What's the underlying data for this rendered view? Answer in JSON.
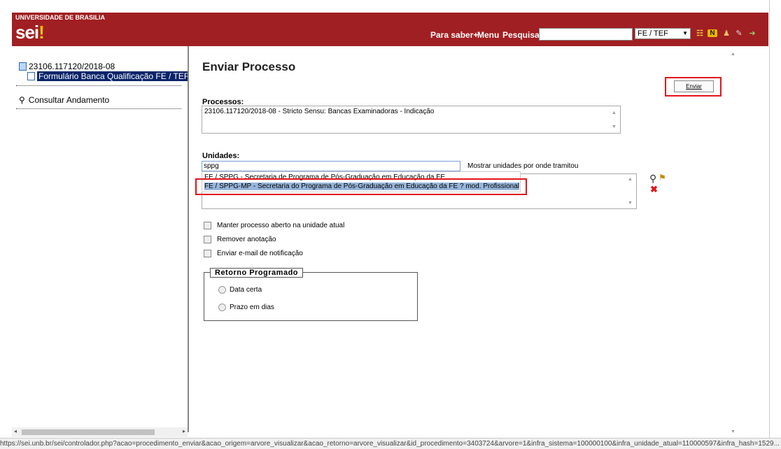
{
  "header": {
    "institution": "UNIVERSIDADE DE BRASILIA",
    "logo_text": "sei",
    "links": [
      "Para saber+",
      "Menu",
      "Pesquisa"
    ],
    "search_value": "",
    "unit_select": "FE / TEF",
    "icons": [
      "list-icon",
      "notification-n-icon",
      "user-icon",
      "tools-icon",
      "exit-icon"
    ]
  },
  "tree": {
    "process_number": "23106.117120/2018-08",
    "document": "Formulário Banca Qualificação FE / TEF",
    "consultar": "Consultar Andamento"
  },
  "main": {
    "title": "Enviar Processo",
    "send_button": "Enviar",
    "processos_label": "Processos:",
    "processos_value": "23106.117120/2018-08 - Stricto Sensu: Bancas Examinadoras - Indicação",
    "unidades_label": "Unidades:",
    "unidades_input": "sppg",
    "mostrar_label": "Mostrar unidades por onde tramitou",
    "suggestions": [
      "FE / SPPG - Secretaria de Programa de Pós-Graduação em Educação da FE",
      "FE / SPPG-MP - Secretaria do Programa de Pós-Graduação em Educação da FE ? mod. Profissional"
    ],
    "checkboxes": [
      "Manter processo aberto na unidade atual",
      "Remover anotação",
      "Enviar e-mail de notificação"
    ],
    "retorno_legend": "Retorno Programado",
    "radios": [
      "Data certa",
      "Prazo em dias"
    ]
  },
  "status_url": "https://sei.unb.br/sei/controlador.php?acao=procedimento_enviar&acao_origem=arvore_visualizar&acao_retorno=arvore_visualizar&id_procedimento=3403724&arvore=1&infra_sistema=100000100&infra_unidade_atual=110000597&infra_hash=1529..."
}
